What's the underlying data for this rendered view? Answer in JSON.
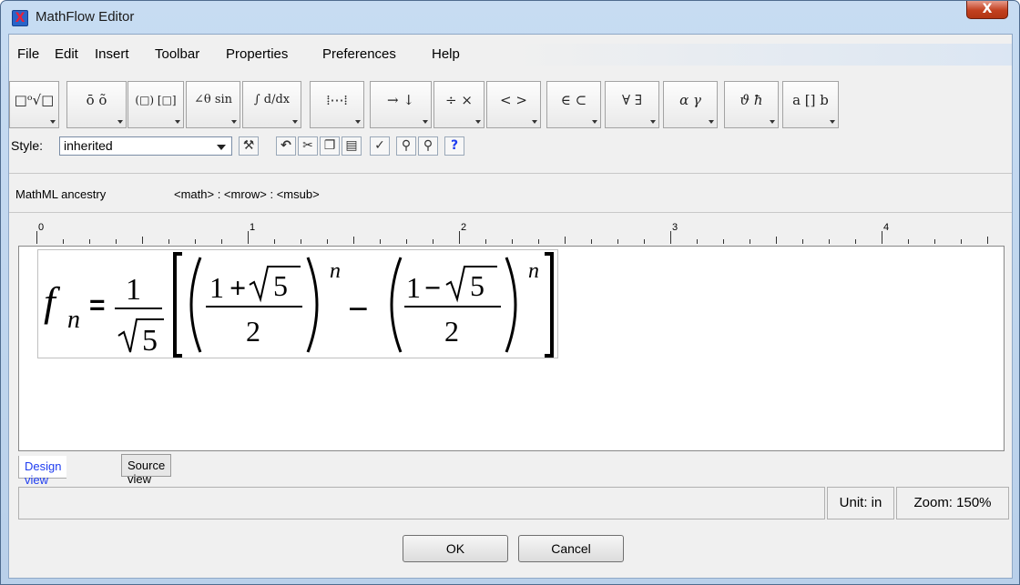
{
  "window": {
    "title": "MathFlow Editor",
    "close_label": "X"
  },
  "menu": [
    "File",
    "Edit",
    "Insert",
    "Toolbar",
    "Properties",
    "Preferences",
    "Help"
  ],
  "toolbar": {
    "buttons": [
      {
        "label": "□ᵒ√□",
        "icon": "script-radical-palette-icon"
      },
      {
        "label": "ō õ",
        "icon": "accent-palette-icon"
      },
      {
        "label": "(□) [□]",
        "icon": "fence-palette-icon"
      },
      {
        "label": "∠θ sin",
        "icon": "function-palette-icon"
      },
      {
        "label": "∫ d/dx",
        "icon": "calculus-palette-icon"
      },
      {
        "label": "⁞⋯⁞",
        "icon": "matrix-palette-icon"
      },
      {
        "label": "→ ↓",
        "icon": "arrow-palette-icon"
      },
      {
        "label": "÷ ×",
        "icon": "operator-palette-icon"
      },
      {
        "label": "< >",
        "icon": "relation-palette-icon"
      },
      {
        "label": "∈ ⊂",
        "icon": "set-palette-icon"
      },
      {
        "label": "∀ ∃",
        "icon": "logic-palette-icon"
      },
      {
        "label": "α γ",
        "icon": "greek-palette-icon"
      },
      {
        "label": "ϑ ħ",
        "icon": "symbol-palette-icon"
      },
      {
        "label": "a [] b",
        "icon": "space-palette-icon"
      }
    ]
  },
  "style_bar": {
    "label": "Style:",
    "value": "inherited",
    "icons": [
      "wrench-icon",
      "undo-icon",
      "cut-icon",
      "copy-icon",
      "paste-icon",
      "check-icon",
      "zoom-in-icon",
      "zoom-out-icon",
      "help-icon"
    ]
  },
  "ancestry": {
    "label": "MathML ancestry",
    "path": "<math> : <mrow> : <msub>"
  },
  "ruler": [
    "0",
    "1",
    "2",
    "3",
    "4"
  ],
  "tabs": {
    "design": "Design view",
    "source": "Source view"
  },
  "status": {
    "unit": "Unit: in",
    "zoom": "Zoom: 150%"
  },
  "buttons": {
    "ok": "OK",
    "cancel": "Cancel"
  },
  "equation": {
    "lhs": "f",
    "lhs_sub": "n",
    "eq": "=",
    "frac1_num": "1",
    "frac1_den": "5",
    "a_num_one": "1",
    "a_num_plus": "+",
    "a_num_five": "5",
    "a_den": "2",
    "a_exp": "n",
    "minus": "−",
    "b_num_one": "1",
    "b_num_minus": "−",
    "b_num_five": "5",
    "b_den": "2",
    "b_exp": "n"
  }
}
